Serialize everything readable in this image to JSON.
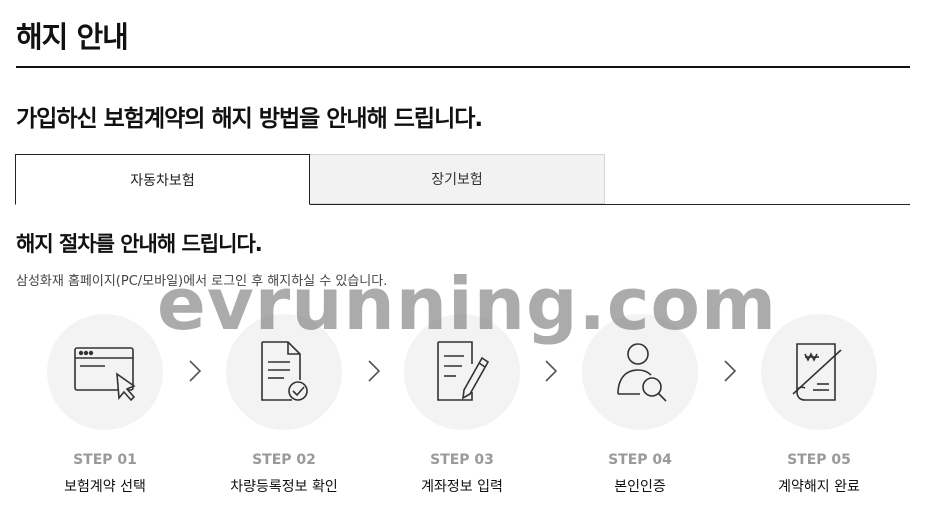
{
  "header": {
    "title": "해지 안내"
  },
  "intro": {
    "lead": "가입하신 보험계약의 해지 방법을 안내해 드립니다."
  },
  "tabs": [
    {
      "label": "자동차보험",
      "active": true
    },
    {
      "label": "장기보험",
      "active": false
    }
  ],
  "procedure": {
    "heading": "해지 절차를 안내해 드립니다.",
    "note": "삼성화재 홈페이지(PC/모바일)에서 로그인 후 해지하실 수 있습니다."
  },
  "steps": [
    {
      "number": "STEP 01",
      "label": "보험계약 선택",
      "icon": "browser-cursor-icon"
    },
    {
      "number": "STEP 02",
      "label": "차량등록정보 확인",
      "icon": "document-check-icon"
    },
    {
      "number": "STEP 03",
      "label": "계좌정보 입력",
      "icon": "document-pen-icon"
    },
    {
      "number": "STEP 04",
      "label": "본인인증",
      "icon": "user-search-icon"
    },
    {
      "number": "STEP 05",
      "label": "계약해지 완료",
      "icon": "cancelled-contract-icon"
    }
  ],
  "watermark": "evrunning.com",
  "colors": {
    "text": "#111111",
    "muted": "#9a9a9a",
    "circle": "#f3f3f3",
    "inactive_tab": "#f2f2f2"
  }
}
